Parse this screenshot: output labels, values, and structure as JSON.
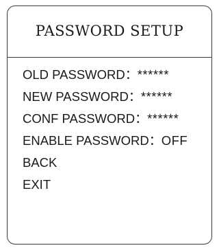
{
  "window": {
    "title": "PASSWORD SETUP"
  },
  "menu": {
    "items": [
      {
        "label": "OLD PASSWORD",
        "separator": "：",
        "value": "******"
      },
      {
        "label": "NEW PASSWORD",
        "separator": "：",
        "value": "******"
      },
      {
        "label": "CONF PASSWORD",
        "separator": "：",
        "value": "******"
      },
      {
        "label": "ENABLE PASSWORD",
        "separator": "：",
        "value": "OFF"
      },
      {
        "label": "BACK"
      },
      {
        "label": "EXIT"
      }
    ]
  }
}
